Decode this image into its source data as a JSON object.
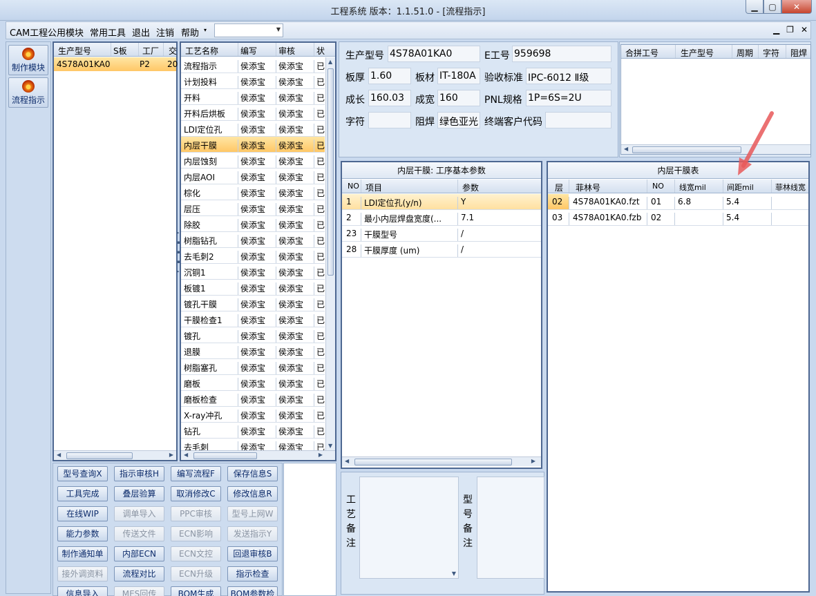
{
  "window": {
    "title": "工程系统  版本：1.1.51.0 - [流程指示]",
    "min_icon": "minimize-icon",
    "max_icon": "maximize-icon",
    "close_icon": "close-icon"
  },
  "menu": {
    "items": [
      "CAM工程",
      "公用模块",
      "常用工具",
      "退出",
      "注销",
      "帮助"
    ],
    "help_arrow": "▾",
    "combo_value": ""
  },
  "left_toolbar": {
    "items": [
      {
        "label": "制作模块",
        "icon": "make-module-icon"
      },
      {
        "label": "流程指示",
        "icon": "flow-indicator-icon"
      }
    ]
  },
  "product_grid": {
    "headers": [
      "生产型号",
      "S板",
      "工厂",
      "交"
    ],
    "rows": [
      {
        "model": "4S78A01KA0",
        "s": "",
        "factory": "P2",
        "due": "20"
      }
    ]
  },
  "process_grid": {
    "headers": [
      "工艺名称",
      "编写",
      "审核",
      "状"
    ],
    "selected_index": 5,
    "rows": [
      {
        "name": "流程指示",
        "writer": "侯添宝",
        "reviewer": "侯添宝",
        "status": "已"
      },
      {
        "name": "计划投料",
        "writer": "侯添宝",
        "reviewer": "侯添宝",
        "status": "已"
      },
      {
        "name": "开料",
        "writer": "侯添宝",
        "reviewer": "侯添宝",
        "status": "已"
      },
      {
        "name": "开料后烘板",
        "writer": "侯添宝",
        "reviewer": "侯添宝",
        "status": "已"
      },
      {
        "name": "LDI定位孔",
        "writer": "侯添宝",
        "reviewer": "侯添宝",
        "status": "已"
      },
      {
        "name": "内层干膜",
        "writer": "侯添宝",
        "reviewer": "侯添宝",
        "status": "已"
      },
      {
        "name": "内层蚀刻",
        "writer": "侯添宝",
        "reviewer": "侯添宝",
        "status": "已"
      },
      {
        "name": "内层AOI",
        "writer": "侯添宝",
        "reviewer": "侯添宝",
        "status": "已"
      },
      {
        "name": "棕化",
        "writer": "侯添宝",
        "reviewer": "侯添宝",
        "status": "已"
      },
      {
        "name": "层压",
        "writer": "侯添宝",
        "reviewer": "侯添宝",
        "status": "已"
      },
      {
        "name": "除胶",
        "writer": "侯添宝",
        "reviewer": "侯添宝",
        "status": "已"
      },
      {
        "name": "树脂钻孔",
        "writer": "侯添宝",
        "reviewer": "侯添宝",
        "status": "已"
      },
      {
        "name": "去毛刺2",
        "writer": "侯添宝",
        "reviewer": "侯添宝",
        "status": "已"
      },
      {
        "name": "沉铜1",
        "writer": "侯添宝",
        "reviewer": "侯添宝",
        "status": "已"
      },
      {
        "name": "板镀1",
        "writer": "侯添宝",
        "reviewer": "侯添宝",
        "status": "已"
      },
      {
        "name": "镀孔干膜",
        "writer": "侯添宝",
        "reviewer": "侯添宝",
        "status": "已"
      },
      {
        "name": "干膜检查1",
        "writer": "侯添宝",
        "reviewer": "侯添宝",
        "status": "已"
      },
      {
        "name": "镀孔",
        "writer": "侯添宝",
        "reviewer": "侯添宝",
        "status": "已"
      },
      {
        "name": "退膜",
        "writer": "侯添宝",
        "reviewer": "侯添宝",
        "status": "已"
      },
      {
        "name": "树脂塞孔",
        "writer": "侯添宝",
        "reviewer": "侯添宝",
        "status": "已"
      },
      {
        "name": "磨板",
        "writer": "侯添宝",
        "reviewer": "侯添宝",
        "status": "已"
      },
      {
        "name": "磨板检查",
        "writer": "侯添宝",
        "reviewer": "侯添宝",
        "status": "已"
      },
      {
        "name": "X-ray冲孔",
        "writer": "侯添宝",
        "reviewer": "侯添宝",
        "status": "已"
      },
      {
        "name": "钻孔",
        "writer": "侯添宝",
        "reviewer": "侯添宝",
        "status": "已"
      },
      {
        "name": "去毛刺",
        "writer": "侯添宝",
        "reviewer": "侯添宝",
        "status": "已"
      }
    ]
  },
  "actions": {
    "rows": [
      [
        {
          "label": "型号查询X",
          "enabled": true
        },
        {
          "label": "指示审核H",
          "enabled": true
        },
        {
          "label": "编写流程F",
          "enabled": true
        },
        {
          "label": "保存信息S",
          "enabled": true
        }
      ],
      [
        {
          "label": "工具完成",
          "enabled": true
        },
        {
          "label": "叠层验算",
          "enabled": true
        },
        {
          "label": "取消修改C",
          "enabled": true
        },
        {
          "label": "修改信息R",
          "enabled": true
        }
      ],
      [
        {
          "label": "在线WIP",
          "enabled": true
        },
        {
          "label": "调单导入",
          "enabled": false
        },
        {
          "label": "PPC审核",
          "enabled": false
        },
        {
          "label": "型号上网W",
          "enabled": false
        }
      ],
      [
        {
          "label": "能力参数",
          "enabled": true
        },
        {
          "label": "传送文件",
          "enabled": false
        },
        {
          "label": "ECN影响",
          "enabled": false
        },
        {
          "label": "发送指示Y",
          "enabled": false
        }
      ],
      [
        {
          "label": "制作通知单",
          "enabled": true
        },
        {
          "label": "内部ECN",
          "enabled": true
        },
        {
          "label": "ECN文控",
          "enabled": false
        },
        {
          "label": "回退审核B",
          "enabled": true
        }
      ],
      [
        {
          "label": "接外调资料",
          "enabled": false
        },
        {
          "label": "流程对比",
          "enabled": true
        },
        {
          "label": "ECN升级",
          "enabled": false
        },
        {
          "label": "指示检查",
          "enabled": true
        }
      ],
      [
        {
          "label": "信息导入",
          "enabled": true
        },
        {
          "label": "MES回传",
          "enabled": false
        },
        {
          "label": "BOM生成",
          "enabled": true
        },
        {
          "label": "BOM参数检查",
          "enabled": true
        }
      ]
    ]
  },
  "info": {
    "model_label": "生产型号",
    "model_value": "4S78A01KA0",
    "e_label": "E工号",
    "e_value": "959698",
    "thickness_label": "板厚",
    "thickness_value": "1.60",
    "material_label": "板材",
    "material_value": "IT-180A",
    "standard_label": "验收标准",
    "standard_value": "IPC-6012 Ⅱ级",
    "length_label": "成长",
    "length_value": "160.03",
    "width_label": "成宽",
    "width_value": "160",
    "pnl_label": "PNL规格",
    "pnl_value": "1P=6S=2U",
    "char_label": "字符",
    "char_value": "",
    "mask_label": "阻焊",
    "mask_value": "绿色亚光",
    "customer_label": "终端客户代码",
    "customer_value": ""
  },
  "merge_grid": {
    "headers": [
      "合拼工号",
      "生产型号",
      "周期",
      "字符",
      "阻焊"
    ]
  },
  "params": {
    "title": "内层干膜: 工序基本参数",
    "headers": [
      "NO",
      "项目",
      "参数"
    ],
    "rows": [
      {
        "no": "1",
        "item": "LDI定位孔(y/n)",
        "value": "Y"
      },
      {
        "no": "2",
        "item": "最小内层焊盘宽度(...",
        "value": "7.1"
      },
      {
        "no": "23",
        "item": "干膜型号",
        "value": "/"
      },
      {
        "no": "28",
        "item": "干膜厚度 (um)",
        "value": "/"
      }
    ]
  },
  "film": {
    "title": "内层干膜表",
    "headers": [
      "层",
      "菲林号",
      "NO",
      "线宽mil",
      "间距mil",
      "菲林线宽"
    ],
    "rows": [
      {
        "layer": "02",
        "film": "4S78A01KA0.fzt",
        "no": "01",
        "width": "6.8",
        "spacing": "5.4"
      },
      {
        "layer": "03",
        "film": "4S78A01KA0.fzb",
        "no": "02",
        "width": "",
        "spacing": "5.4"
      }
    ]
  },
  "notes": {
    "process_label": "工艺备注",
    "model_label": "型号备注"
  }
}
